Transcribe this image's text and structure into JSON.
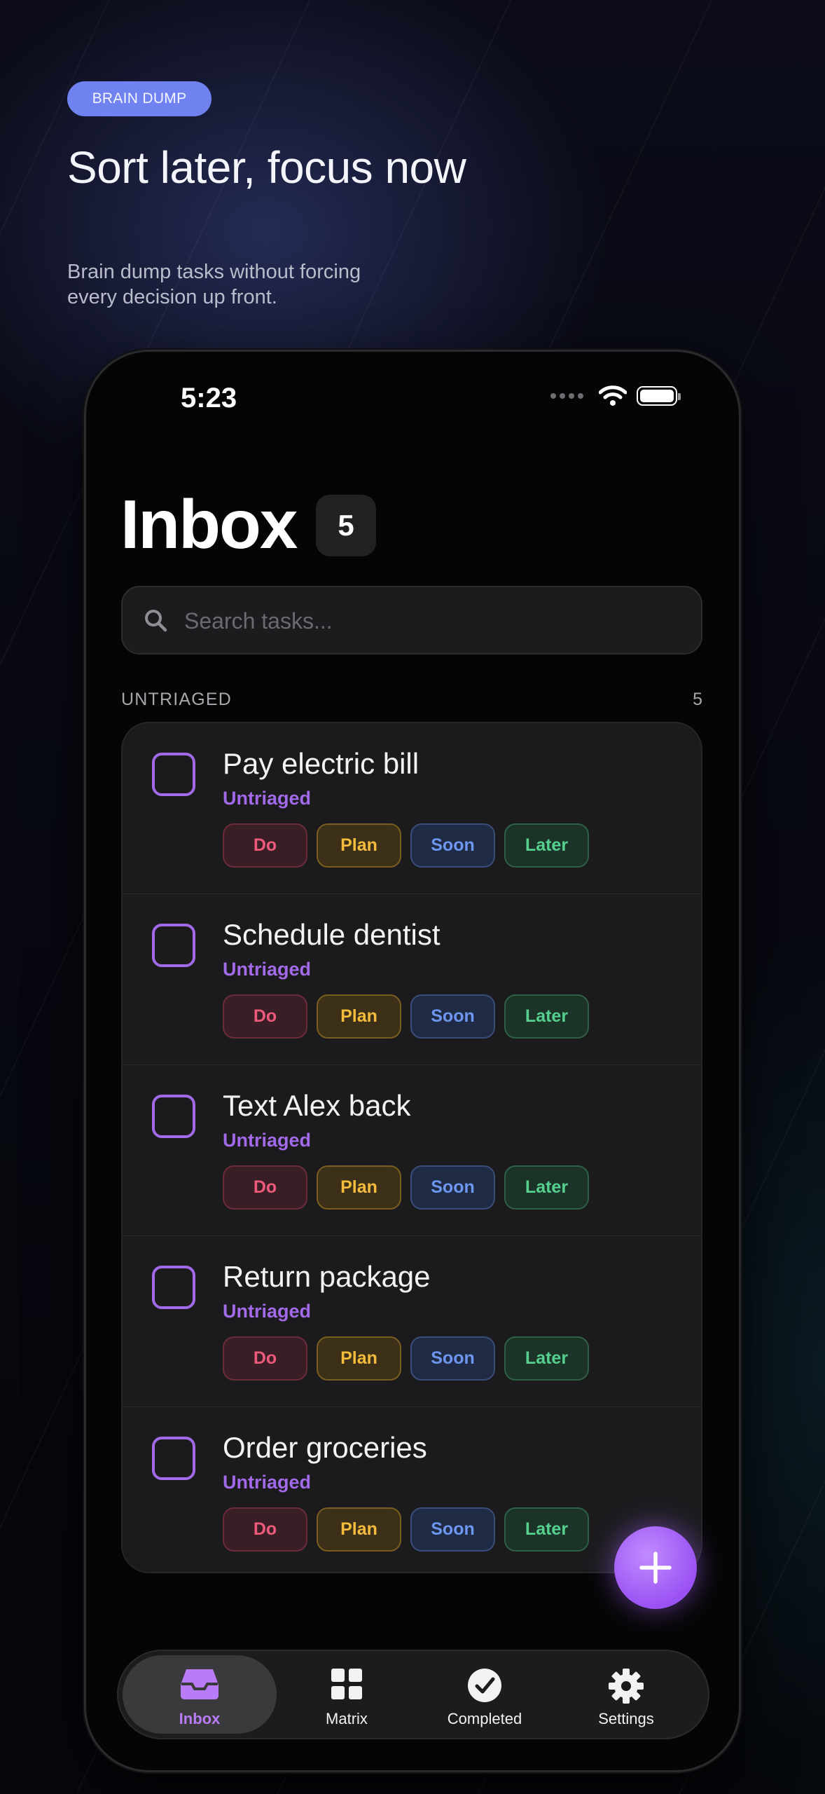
{
  "promo": {
    "badge": "BRAIN DUMP",
    "headline": "Sort later, focus now",
    "subline_1": "Brain dump tasks without forcing",
    "subline_2": "every decision up front."
  },
  "status_bar": {
    "time": "5:23"
  },
  "inbox": {
    "title": "Inbox",
    "count": "5",
    "search_placeholder": "Search tasks...",
    "section_label": "UNTRIAGED",
    "section_count": "5"
  },
  "pill_labels": {
    "do": "Do",
    "plan": "Plan",
    "soon": "Soon",
    "later": "Later"
  },
  "tasks": [
    {
      "title": "Pay electric bill",
      "status": "Untriaged"
    },
    {
      "title": "Schedule dentist",
      "status": "Untriaged"
    },
    {
      "title": "Text Alex back",
      "status": "Untriaged"
    },
    {
      "title": "Return package",
      "status": "Untriaged"
    },
    {
      "title": "Order groceries",
      "status": "Untriaged"
    }
  ],
  "tabbar": {
    "inbox": "Inbox",
    "matrix": "Matrix",
    "completed": "Completed",
    "settings": "Settings"
  },
  "icons": {
    "search": "search-icon",
    "add": "plus-icon",
    "inbox": "inbox-tray-icon",
    "matrix": "grid-icon",
    "completed": "checkmark-circle-icon",
    "settings": "gear-icon"
  },
  "colors": {
    "accent": "#a26ae9",
    "promo_badge": "#6f82f0",
    "do": "#ee5a7b",
    "plan": "#f4bb3d",
    "soon": "#6d96ee",
    "later": "#55d08f"
  }
}
